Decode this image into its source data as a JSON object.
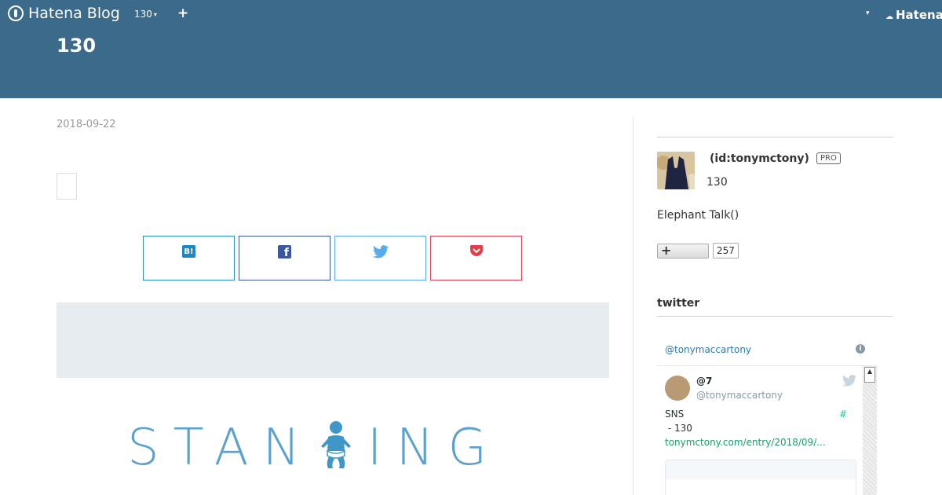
{
  "header": {
    "logo_text": "Hatena Blog",
    "blog_menu_label": "130",
    "add_label": "+",
    "right_brand": "Hatena",
    "blog_title": "130",
    "colors": {
      "header_bg": "#3c6a8a",
      "text": "#ffffff"
    }
  },
  "entry": {
    "date": "2018-09-22",
    "share_buttons": [
      {
        "service": "hatena-bookmark",
        "icon": "hatena-bookmark-icon",
        "icon_text": "B!",
        "color": "#1e88c7"
      },
      {
        "service": "facebook",
        "icon": "facebook-icon",
        "icon_text": "f",
        "color": "#3b5998"
      },
      {
        "service": "twitter",
        "icon": "twitter-bird-icon",
        "color": "#55acee"
      },
      {
        "service": "pocket",
        "icon": "pocket-icon",
        "color": "#e0404c"
      }
    ],
    "banner_text": "STANDING"
  },
  "sidebar": {
    "profile": {
      "name": "(id:tonymctony)",
      "badge": "PRO",
      "sub": "130",
      "description": "Elephant Talk()",
      "follow_label": "+",
      "follow_count": "257"
    },
    "twitter": {
      "heading": "twitter",
      "user_link": "@tonymaccartony",
      "info_icon": "i",
      "tweet": {
        "name": "@7",
        "handle": "@tonymaccartony",
        "text1": "SNS",
        "hash": "#",
        "text2": " - 130",
        "link": "tonymctony.com/entry/2018/09/..."
      }
    }
  }
}
